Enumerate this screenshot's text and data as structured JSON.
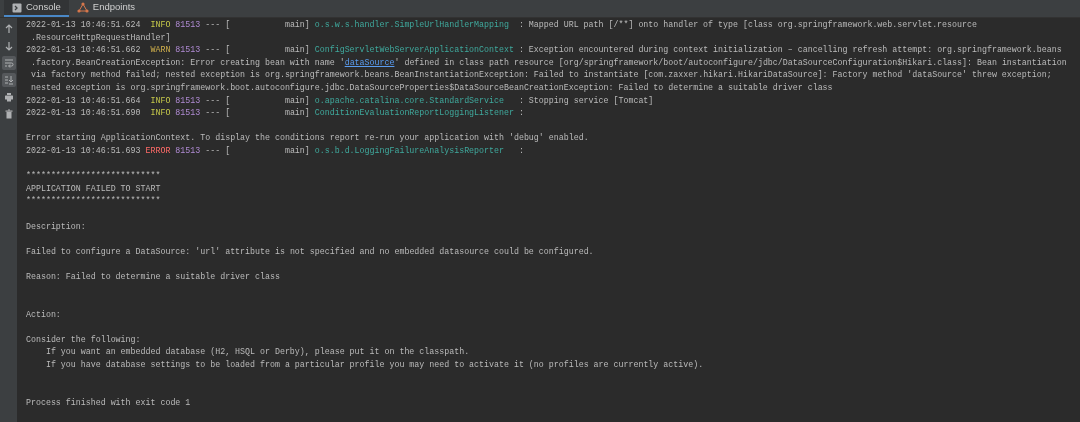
{
  "tabs": [
    {
      "label": "Console",
      "kind": "console",
      "selected": true
    },
    {
      "label": "Endpoints",
      "kind": "endpoints",
      "selected": false
    }
  ],
  "toolbar": [
    {
      "kind": "up",
      "on": false
    },
    {
      "kind": "down",
      "on": false
    },
    {
      "kind": "wrap",
      "on": true
    },
    {
      "kind": "scroll",
      "on": true
    },
    {
      "kind": "print",
      "on": false
    },
    {
      "kind": "trash",
      "on": false
    }
  ],
  "console_lines": [
    {
      "kind": "log",
      "time": "2022-01-13 10:46:51.624",
      "level": "INFO",
      "pid": "81513",
      "thread": "--- [           main]",
      "logger": "o.s.w.s.handler.SimpleUrlHandlerMapping",
      "message": ": Mapped URL path [/**] onto handler of type [class org.springframework.web.servlet.resource"
    },
    {
      "kind": "continuation",
      "parts": [
        {
          "text": ".ResourceHttpRequestHandler]"
        }
      ]
    },
    {
      "kind": "log",
      "time": "2022-01-13 10:46:51.662",
      "level": "WARN",
      "pid": "81513",
      "thread": "--- [           main]",
      "logger": "ConfigServletWebServerApplicationContext",
      "message": ": Exception encountered during context initialization – cancelling refresh attempt: org.springframework.beans"
    },
    {
      "kind": "continuation",
      "parts": [
        {
          "text": ".factory.BeanCreationException: Error creating bean with name '"
        },
        {
          "text": "dataSource",
          "link": true
        },
        {
          "text": "' defined in class path resource [org/springframework/boot/autoconfigure/jdbc/DataSourceConfiguration$Hikari.class]: Bean instantiation"
        }
      ]
    },
    {
      "kind": "continuation",
      "parts": [
        {
          "text": "via factory method failed; nested exception is org.springframework.beans.BeanInstantiationException: Failed to instantiate [com.zaxxer.hikari.HikariDataSource]: Factory method 'dataSource' threw exception;"
        }
      ]
    },
    {
      "kind": "continuation",
      "parts": [
        {
          "text": "nested exception is org.springframework.boot.autoconfigure.jdbc.DataSourceProperties$DataSourceBeanCreationException: Failed to determine a suitable driver class"
        }
      ]
    },
    {
      "kind": "log",
      "time": "2022-01-13 10:46:51.664",
      "level": "INFO",
      "pid": "81513",
      "thread": "--- [           main]",
      "logger": "o.apache.catalina.core.StandardService",
      "message": ": Stopping service [Tomcat]"
    },
    {
      "kind": "log",
      "time": "2022-01-13 10:46:51.690",
      "level": "INFO",
      "pid": "81513",
      "thread": "--- [           main]",
      "logger": "ConditionEvaluationReportLoggingListener",
      "message": ":"
    },
    {
      "kind": "blank"
    },
    {
      "kind": "text",
      "text": "Error starting ApplicationContext. To display the conditions report re-run your application with 'debug' enabled."
    },
    {
      "kind": "log",
      "time": "2022-01-13 10:46:51.693",
      "level": "ERROR",
      "pid": "81513",
      "thread": "--- [           main]",
      "logger": "o.s.b.d.LoggingFailureAnalysisReporter",
      "message": ":"
    },
    {
      "kind": "blank"
    },
    {
      "kind": "text",
      "text": "***************************"
    },
    {
      "kind": "text",
      "text": "APPLICATION FAILED TO START"
    },
    {
      "kind": "text",
      "text": "***************************"
    },
    {
      "kind": "blank"
    },
    {
      "kind": "text",
      "text": "Description:"
    },
    {
      "kind": "blank"
    },
    {
      "kind": "text",
      "text": "Failed to configure a DataSource: 'url' attribute is not specified and no embedded datasource could be configured."
    },
    {
      "kind": "blank"
    },
    {
      "kind": "text",
      "text": "Reason: Failed to determine a suitable driver class"
    },
    {
      "kind": "blank"
    },
    {
      "kind": "blank"
    },
    {
      "kind": "text",
      "text": "Action:"
    },
    {
      "kind": "blank"
    },
    {
      "kind": "text",
      "text": "Consider the following:"
    },
    {
      "kind": "indented",
      "text": "If you want an embedded database (H2, HSQL or Derby), please put it on the classpath."
    },
    {
      "kind": "indented",
      "text": "If you have database settings to be loaded from a particular profile you may need to activate it (no profiles are currently active)."
    },
    {
      "kind": "blank"
    },
    {
      "kind": "blank"
    },
    {
      "kind": "text",
      "text": "Process finished with exit code 1"
    }
  ]
}
